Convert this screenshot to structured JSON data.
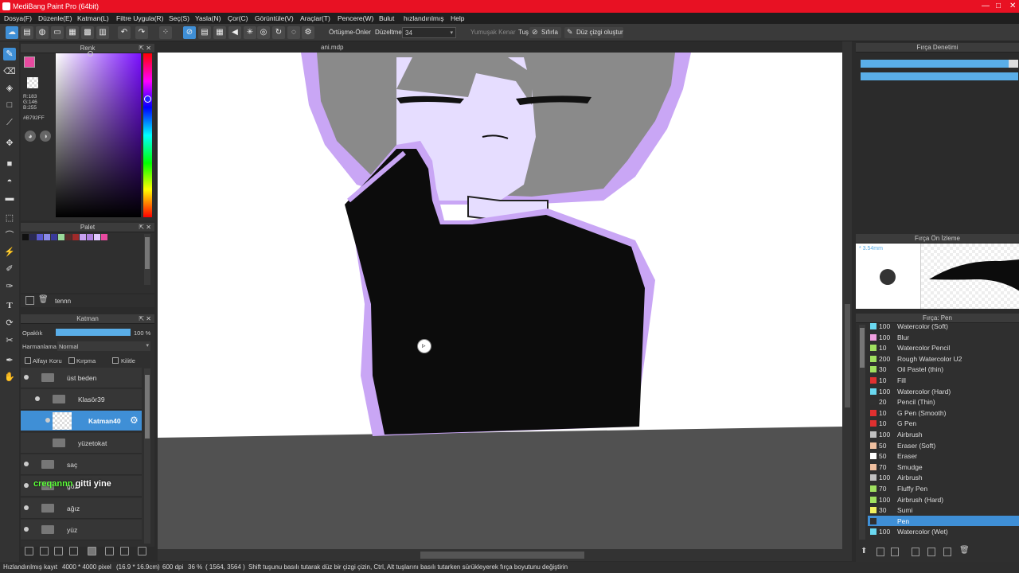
{
  "app": {
    "title": "MediBang Paint Pro (64bit)"
  },
  "menu": [
    "Dosya(F)",
    "Düzenle(E)",
    "Katman(L)",
    "Filtre Uygula(R)",
    "Seç(S)",
    "Yasla(N)",
    "Çor(C)",
    "Görüntüle(V)",
    "Araçlar(T)",
    "Pencere(W)",
    "Bulut",
    "hızlandırılmış",
    "Help"
  ],
  "toolbar": {
    "overlap_label": "Örtüşme-Önler",
    "stabilizer_label": "Düzeltme",
    "stabilizer_value": "34",
    "soft_edge_label": "Yumuşak Kenar",
    "tus_label": "Tuş",
    "reset_label": "Sıfırla",
    "line_label": "Düz çizgi oluştur"
  },
  "color_panel": {
    "title": "Renk",
    "r": "R:183",
    "g": "G:146",
    "b": "B:255",
    "hex": "#B792FF",
    "fg_color": "#e84aa0",
    "bg_color": "#ffffff"
  },
  "palette_panel": {
    "title": "Palet",
    "name": "tennn",
    "swatches": [
      "#101010",
      "#2a2a55",
      "#5a5ad0",
      "#8a8ae8",
      "#3a3a9a",
      "#9ad89a",
      "#5a2a2a",
      "#a02a2a",
      "#c8a0f0",
      "#b080e0",
      "#e0c8ff",
      "#e84aa0"
    ]
  },
  "layer_panel": {
    "title": "Katman",
    "opacity_label": "Opaklık",
    "opacity_value": "100 %",
    "opacity_fraction": 1.0,
    "blend_label": "Harmanlama",
    "blend_value": "Normal",
    "alpha_lock": "Alfayı Koru",
    "clipping": "Kırpma",
    "lock": "Kilitle",
    "layers": [
      {
        "name": "üst beden"
      },
      {
        "name": "Klasör39"
      },
      {
        "name": "Katman40"
      },
      {
        "name": "yüzetokat"
      },
      {
        "name": "saç"
      },
      {
        "name": "göz"
      },
      {
        "name": "ağız"
      },
      {
        "name": "yüz"
      }
    ],
    "overlay_highlight": "creqannn",
    "overlay_text": "gitti yine"
  },
  "canvas": {
    "filename": "ani.mdp"
  },
  "brush_control": {
    "title": "Fırça Denetimi",
    "size_fraction": 0.94,
    "opacity_fraction": 1.0
  },
  "brush_preview": {
    "title": "Fırça Ön İzleme",
    "size_label": "* 3.54mm"
  },
  "brush_list": {
    "title": "Fırça: Pen",
    "items": [
      {
        "size": "100",
        "name": "Watercolor (Soft)",
        "color": "#6ad8f0"
      },
      {
        "size": "100",
        "name": "Blur",
        "color": "#f0a0e0"
      },
      {
        "size": "10",
        "name": "Watercolor Pencil",
        "color": "#a0e060"
      },
      {
        "size": "200",
        "name": "Rough Watercolor U2",
        "color": "#a0e060"
      },
      {
        "size": "30",
        "name": "Oil Pastel (thin)",
        "color": "#a0e060"
      },
      {
        "size": "10",
        "name": "Fill",
        "color": "#e03030"
      },
      {
        "size": "100",
        "name": "Watercolor (Hard)",
        "color": "#6ad8f0"
      },
      {
        "size": "20",
        "name": "Pencil (Thin)",
        "color": "#303030"
      },
      {
        "size": "10",
        "name": "G Pen (Smooth)",
        "color": "#e03030"
      },
      {
        "size": "10",
        "name": "G Pen",
        "color": "#e03030"
      },
      {
        "size": "100",
        "name": "Airbrush",
        "color": "#c0c0c0"
      },
      {
        "size": "50",
        "name": "Eraser (Soft)",
        "color": "#f0c0a0"
      },
      {
        "size": "50",
        "name": "Eraser",
        "color": "#ffffff"
      },
      {
        "size": "70",
        "name": "Smudge",
        "color": "#f0c0a0"
      },
      {
        "size": "100",
        "name": "Airbrush",
        "color": "#c0c0c0"
      },
      {
        "size": "70",
        "name": "Fluffy Pen",
        "color": "#a0e060"
      },
      {
        "size": "100",
        "name": "Airbrush (Hard)",
        "color": "#a0e060"
      },
      {
        "size": "30",
        "name": "Sumi",
        "color": "#f0f060"
      },
      {
        "size": "",
        "name": "Pen",
        "color": "#303030"
      },
      {
        "size": "100",
        "name": "Watercolor (Wet)",
        "color": "#6ad8f0"
      }
    ]
  },
  "status": {
    "left": "Hızlandırılmış kayıt",
    "size": "4000 * 4000 pixel",
    "cm": "(16.9 * 16.9cm)",
    "dpi": "600 dpi",
    "zoom": "36 %",
    "coords": "( 1564, 3564 )",
    "hint": "Shift tuşunu basılı tutarak düz bir çizgi çizin, Ctrl, Alt tuşlarını basılı tutarken sürükleyerek fırça boyutunu değiştirin"
  }
}
